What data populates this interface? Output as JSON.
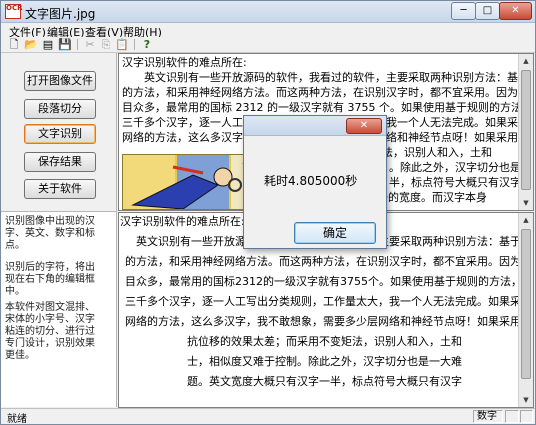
{
  "window": {
    "title": "文字图片.jpg",
    "icon_label": "OCR",
    "min_glyph": "─",
    "max_glyph": "□",
    "close_glyph": "✕"
  },
  "menu": [
    "文件(F)",
    "编辑(E)",
    "查看(V)",
    "帮助(H)"
  ],
  "toolbar": {
    "new_icon": "new-file-icon",
    "open_icon": "open-folder-icon",
    "save_icon": "save-icon",
    "cut_icon": "cut-icon",
    "copy_icon": "copy-icon",
    "paste_icon": "paste-icon",
    "help_icon": "help-icon",
    "new_glyph": "🗋",
    "open_glyph": "📂",
    "save_glyph": "💾",
    "cut_glyph": "✂",
    "copy_glyph": "⎘",
    "paste_glyph": "📋",
    "help_glyph": "?"
  },
  "sidebar": {
    "buttons": [
      "打开图像文件",
      "段落切分",
      "文字识别",
      "保存结果",
      "关于软件"
    ]
  },
  "notes": [
    "识别图像中出现的汉字、英文、数字和标点。",
    "识别后的字符，将出现在右下角的编辑框中。",
    "本软件对图文混排、宋体的小字号、汉字粘连的切分、进行过专门设计，识别效果更佳。"
  ],
  "top_pane": {
    "lines": [
      "汉字识别软件的难点所在:",
      "　　英文识别有一些开放源码的软件，我看过的软件，主要采取两种识别方法：基于规则",
      "的方法，和采用神经网络方法。而这两种方法，在识别汉字时，都不宜采用。因为汉字数",
      "目众多，最常用的国标 2312 的一级汉字就有 3755 个。如果使用基于规则的方法，需要对",
      "三千多个汉字，逐一人工写出分类规则，工作量太大，我一个人无法完成。如果采用神经",
      "网络的方法，这么多汉字，我不敢想象，需要多少层网络和神经节点呀！如果采用网格法，",
      "不变矩法，识别人和入，土和",
      "。除此之外，汉字切分也是一大难",
      "半，标点符号大概只有汉字",
      "字，在汉字切分之一的宽度。而汉字本身"
    ]
  },
  "bottom_pane": {
    "lines": [
      "汉字识别软件的难点所在:",
      "　英文识别有一些开放源码的软件，我看过的软件，主要采取两种识别方法：基于规则",
      "的方法，和采用神经网络方法。而这两种方法，在识别汉字时，都不宜采用。因为汉字数",
      "目众多，最常用的国标2312的一级汉字就有3755个。如果使用基于规则的方法，需要对",
      "三千多个汉字，逐一人工写出分类规则，工作量太大，我一个人无法完成。如果采用神经",
      "网络的方法，这么多汉字，我不敢想象，需要多少层网络和神经节点呀！如果采用网格法，",
      "抗位移的效果太差；而采用不变矩法，识别人和入，土和",
      "士，相似度又难于控制。除此之外，汉字切分也是一大难",
      "题。英文宽度大概只有汉字一半，标点符号大概只有汉字"
    ]
  },
  "dialog": {
    "title": "",
    "close_label": "✕",
    "message": "耗时4.805000秒",
    "ok_label": "确定"
  },
  "status": {
    "text": "就绪",
    "cells": [
      "数字",
      "",
      ""
    ]
  },
  "colors": {
    "focus": "#e07820",
    "ok_border": "#3c7fb1",
    "picture_bg": "#e8c64a"
  }
}
